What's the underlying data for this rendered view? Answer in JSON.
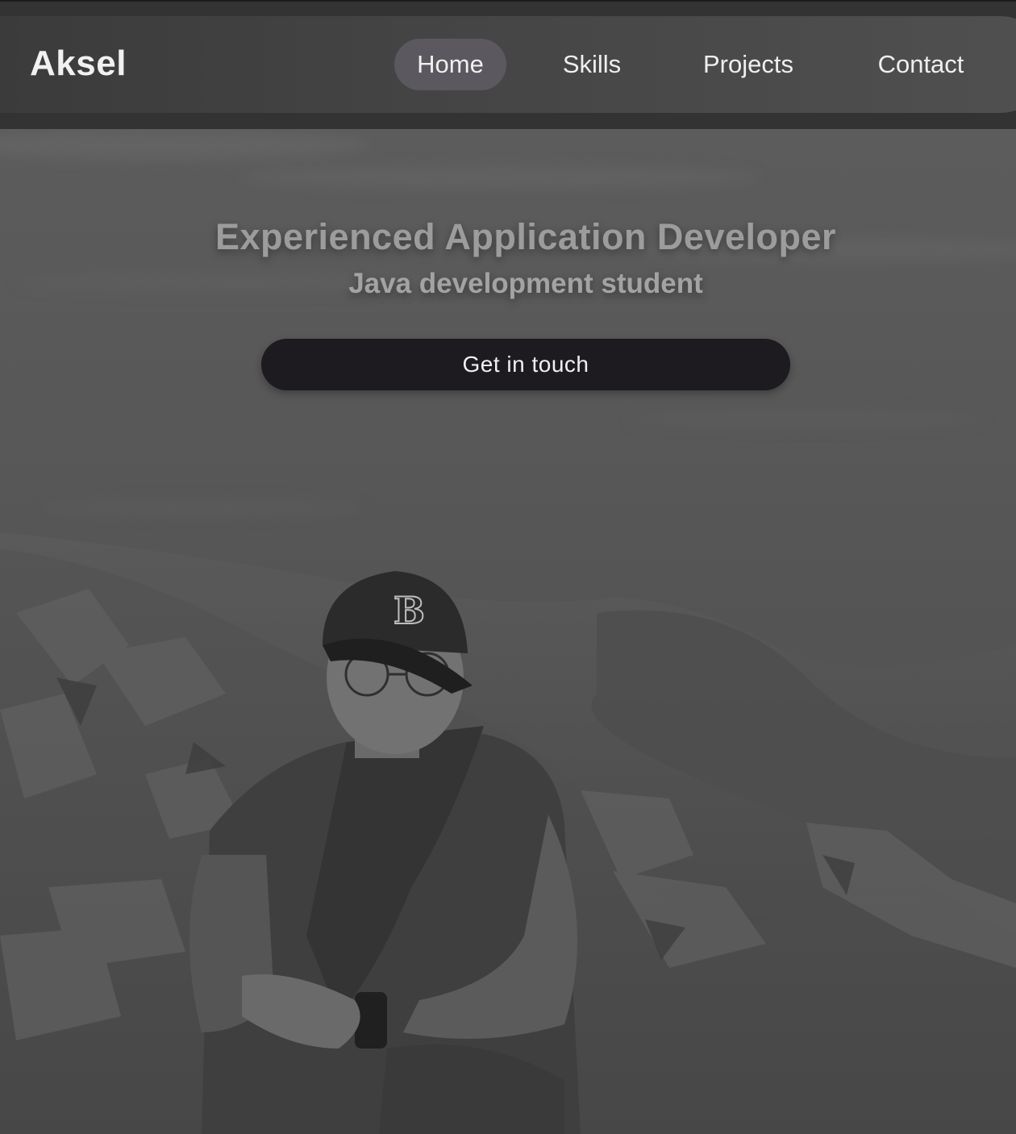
{
  "header": {
    "brand": "Aksel",
    "nav": [
      {
        "label": "Home",
        "active": true
      },
      {
        "label": "Skills",
        "active": false
      },
      {
        "label": "Projects",
        "active": false
      },
      {
        "label": "Contact",
        "active": false
      }
    ]
  },
  "hero": {
    "headline": "Experienced Application Developer",
    "subline": "Java development student",
    "cta_label": "Get in touch"
  },
  "colors": {
    "nav_active_bg": "#5b5860",
    "cta_bg": "#1d1b20"
  },
  "icons": {
    "cap_logo": "B"
  }
}
